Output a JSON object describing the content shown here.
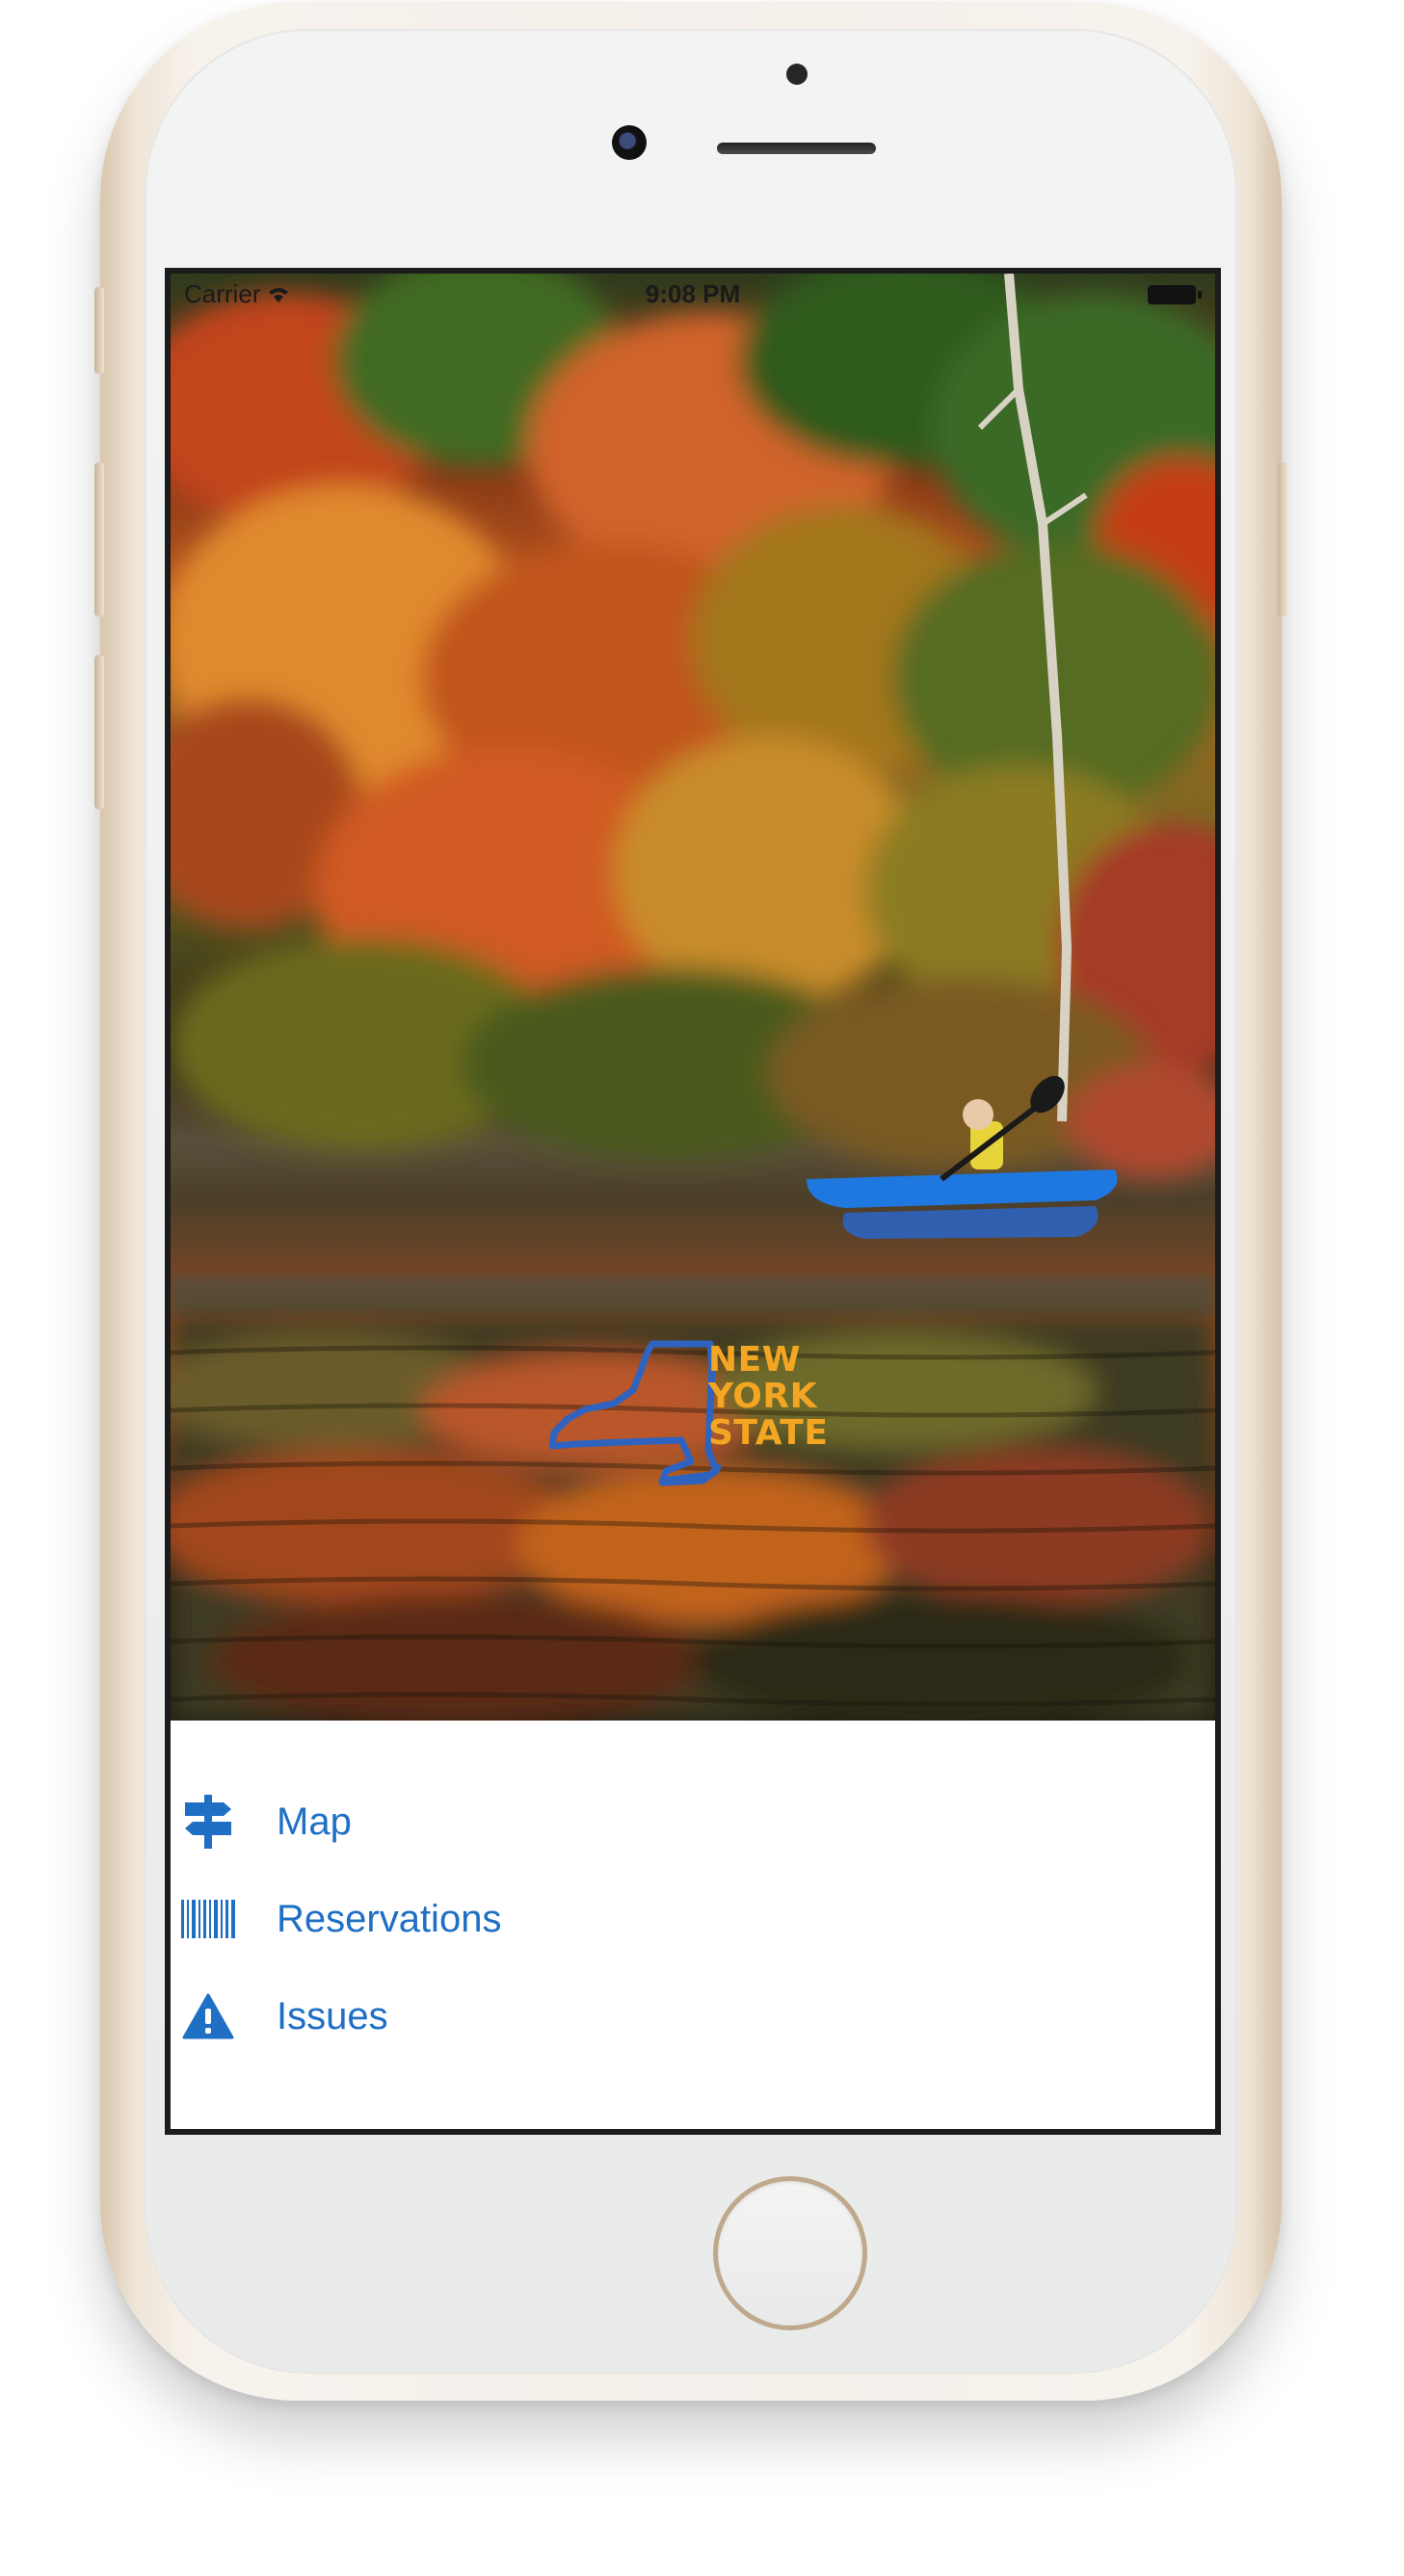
{
  "status_bar": {
    "carrier": "Carrier",
    "time": "9:08 PM"
  },
  "hero": {
    "logo": {
      "lines": [
        "NEW",
        "YORK",
        "STATE"
      ]
    }
  },
  "menu": {
    "items": [
      {
        "label": "Map",
        "icon": "signpost-icon"
      },
      {
        "label": "Reservations",
        "icon": "barcode-icon"
      },
      {
        "label": "Issues",
        "icon": "warning-icon"
      }
    ]
  },
  "colors": {
    "accent": "#1F6FC5",
    "logo_orange": "#F4A623",
    "logo_blue": "#2F63C0"
  }
}
